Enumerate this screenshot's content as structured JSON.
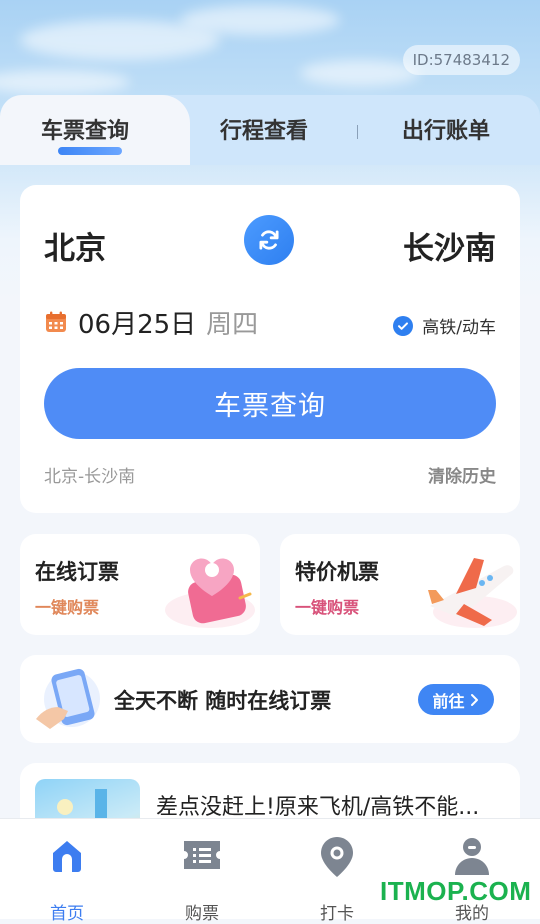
{
  "header": {
    "user_id": "ID:57483412"
  },
  "tabs": [
    {
      "label": "车票查询",
      "active": true
    },
    {
      "label": "行程查看",
      "active": false
    },
    {
      "label": "出行账单",
      "active": false
    }
  ],
  "search": {
    "from_city": "北京",
    "to_city": "长沙南",
    "date": "06月25日",
    "weekday": "周四",
    "train_option": "高铁/动车",
    "train_option_checked": true,
    "button_label": "车票查询",
    "history_item": "北京-长沙南",
    "clear_history": "清除历史"
  },
  "promo_cards": [
    {
      "title": "在线订票",
      "subtitle": "一键购票",
      "subtitle_color": "#e0875a"
    },
    {
      "title": "特价机票",
      "subtitle": "一键购票",
      "subtitle_color": "#d8527a"
    }
  ],
  "banner": {
    "text": "全天不断 随时在线订票",
    "button_label": "前往"
  },
  "news": {
    "title": "差点没赶上!原来飞机/高铁不能..."
  },
  "bottom_nav": [
    {
      "label": "首页",
      "icon": "home-icon",
      "active": true
    },
    {
      "label": "购票",
      "icon": "ticket-icon",
      "active": false
    },
    {
      "label": "打卡",
      "icon": "location-pin-icon",
      "active": false
    },
    {
      "label": "我的",
      "icon": "user-icon",
      "active": false
    }
  ],
  "watermark": "ITMOP.COM",
  "colors": {
    "primary": "#4f8cf6",
    "accent_blue": "#2e7ff0",
    "watermark_green": "#1bb24f"
  }
}
